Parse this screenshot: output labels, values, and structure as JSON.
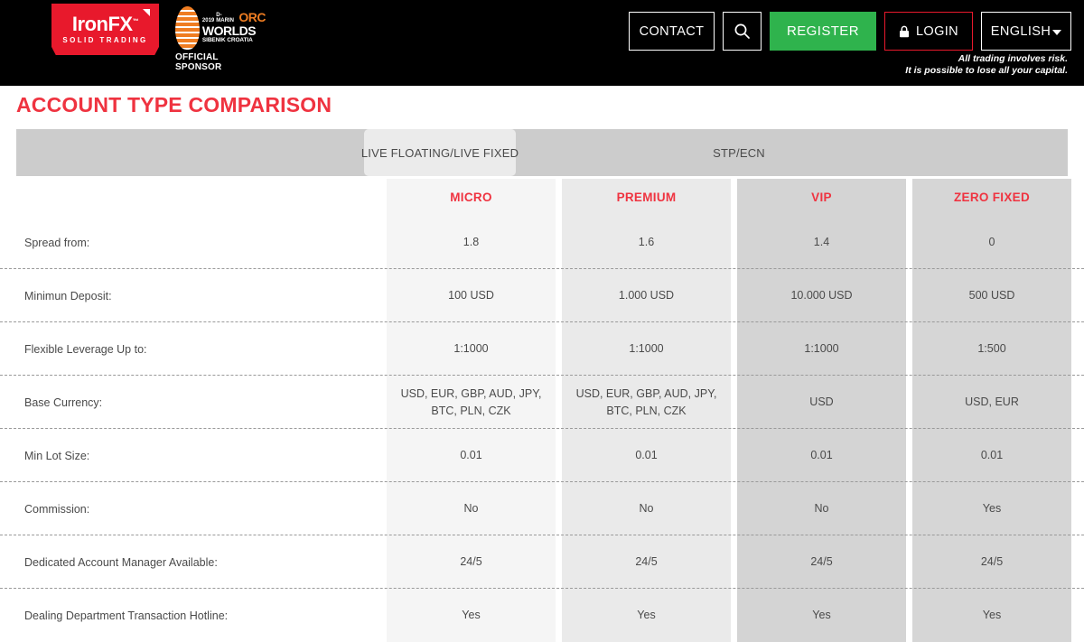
{
  "header": {
    "logo": {
      "name": "IronFX",
      "tagline": "SOLID TRADING",
      "trademark": "™"
    },
    "sponsor": {
      "year": "2019",
      "presenter": "D-MARIN",
      "event": "ORC",
      "worlds": "WORLDS",
      "location": "SIBENIK CROATIA",
      "role": "OFFICIAL SPONSOR"
    },
    "nav": {
      "contact": "CONTACT",
      "search_icon": "search-icon",
      "register": "REGISTER",
      "login": "LOGIN",
      "login_icon": "lock-icon",
      "language": "ENGLISH",
      "language_caret": "chevron-down-icon"
    },
    "risk_warning": "All trading involves risk.\nIt is possible to lose all your capital."
  },
  "page": {
    "title": "ACCOUNT TYPE COMPARISON"
  },
  "tabs": [
    {
      "label": "LIVE FLOATING/LIVE FIXED",
      "active": true
    },
    {
      "label": "STP/ECN",
      "active": false
    }
  ],
  "table": {
    "columns": [
      "MICRO",
      "PREMIUM",
      "VIP",
      "ZERO FIXED"
    ],
    "rows": [
      {
        "label": "Spread from:",
        "values": [
          "1.8",
          "1.6",
          "1.4",
          "0"
        ]
      },
      {
        "label": "Minimun Deposit:",
        "values": [
          "100 USD",
          "1.000 USD",
          "10.000 USD",
          "500 USD"
        ]
      },
      {
        "label": "Flexible Leverage Up to:",
        "values": [
          "1:1000",
          "1:1000",
          "1:1000",
          "1:500"
        ]
      },
      {
        "label": "Base Currency:",
        "values": [
          "USD, EUR, GBP, AUD, JPY,\nBTC, PLN, CZK",
          "USD, EUR, GBP, AUD, JPY,\nBTC, PLN, CZK",
          "USD",
          "USD, EUR"
        ]
      },
      {
        "label": "Min Lot Size:",
        "values": [
          "0.01",
          "0.01",
          "0.01",
          "0.01"
        ]
      },
      {
        "label": "Commission:",
        "values": [
          "No",
          "No",
          "No",
          "Yes"
        ]
      },
      {
        "label": "Dedicated Account Manager Available:",
        "values": [
          "24/5",
          "24/5",
          "24/5",
          "24/5"
        ]
      },
      {
        "label": "Dealing Department Transaction Hotline:",
        "values": [
          "Yes",
          "Yes",
          "Yes",
          "Yes"
        ]
      }
    ]
  },
  "colors": {
    "brand_red": "#e8192c",
    "accent_red": "#ef3340",
    "register_green": "#2fb34d",
    "sponsor_orange": "#ef7d22",
    "header_black": "#000000",
    "tab_band": "#cccccc",
    "tab_active": "#ebebeb",
    "col_micro": "#f5f5f5",
    "col_premium": "#eaeaea",
    "col_vip": "#d4d4d4",
    "col_zero": "#d6d6d6"
  }
}
